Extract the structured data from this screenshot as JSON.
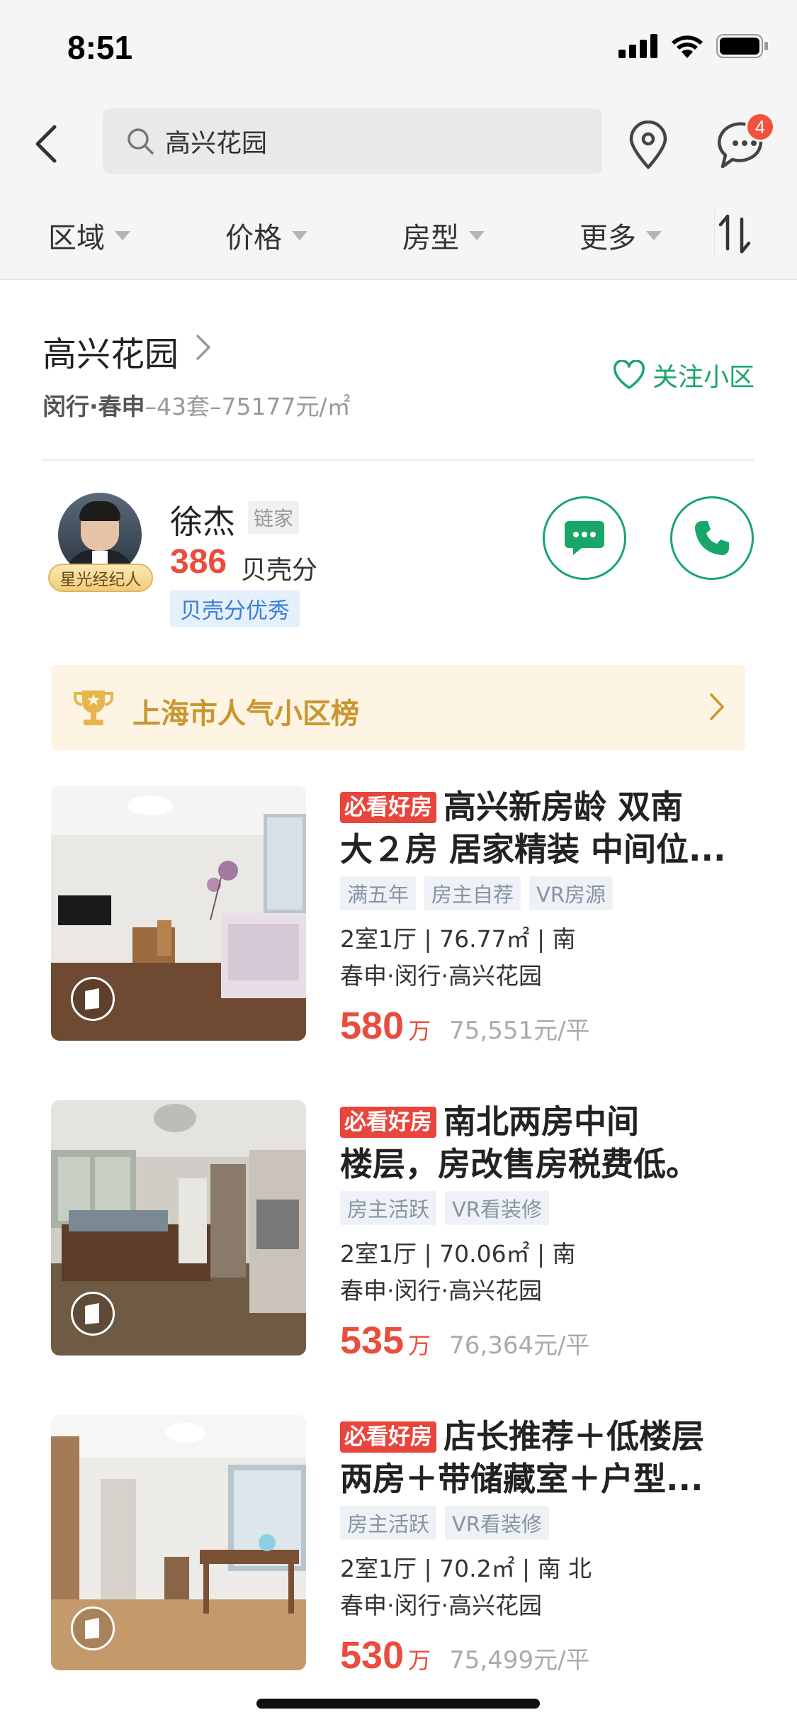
{
  "status_bar": {
    "time": "8:51"
  },
  "search": {
    "query": "高兴花园",
    "message_badge": "4"
  },
  "filters": [
    {
      "label": "区域"
    },
    {
      "label": "价格"
    },
    {
      "label": "房型"
    },
    {
      "label": "更多"
    }
  ],
  "community": {
    "name": "高兴花园",
    "district": "闵行·春申",
    "count": "–43套",
    "avg_price": "–75177元/㎡",
    "follow_label": "关注小区"
  },
  "agent": {
    "name": "徐杰",
    "company": "链家",
    "score": "386",
    "score_label": "贝壳分",
    "tag": "贝壳分优秀",
    "badge": "星光经纪人"
  },
  "ranking": {
    "label": "上海市人气小区榜"
  },
  "listings": [
    {
      "must_tag": "必看好房",
      "title_line1": "高兴新房龄 双南",
      "title_line2": "大２房 居家精装 中间位...",
      "tags": [
        "满五年",
        "房主自荐",
        "VR房源"
      ],
      "spec": "2室1厅 | 76.77㎡ | 南",
      "location": "春申·闵行·高兴花园",
      "price": "580",
      "price_unit": "万",
      "unit_price": "75,551元/平"
    },
    {
      "must_tag": "必看好房",
      "title_line1": "南北两房中间",
      "title_line2": "楼层，房改售房税费低。",
      "tags": [
        "房主活跃",
        "VR看装修"
      ],
      "spec": "2室1厅 | 70.06㎡ | 南",
      "location": "春申·闵行·高兴花园",
      "price": "535",
      "price_unit": "万",
      "unit_price": "76,364元/平"
    },
    {
      "must_tag": "必看好房",
      "title_line1": "店长推荐＋低楼层",
      "title_line2": "两房＋带储藏室＋户型...",
      "tags": [
        "房主活跃",
        "VR看装修"
      ],
      "spec": "2室1厅 | 70.2㎡ | 南 北",
      "location": "春申·闵行·高兴花园",
      "price": "530",
      "price_unit": "万",
      "unit_price": "75,499元/平"
    }
  ],
  "colors": {
    "accent_green": "#18a66a",
    "price_red": "#e84d3d",
    "rank_gold": "#c9962f"
  }
}
